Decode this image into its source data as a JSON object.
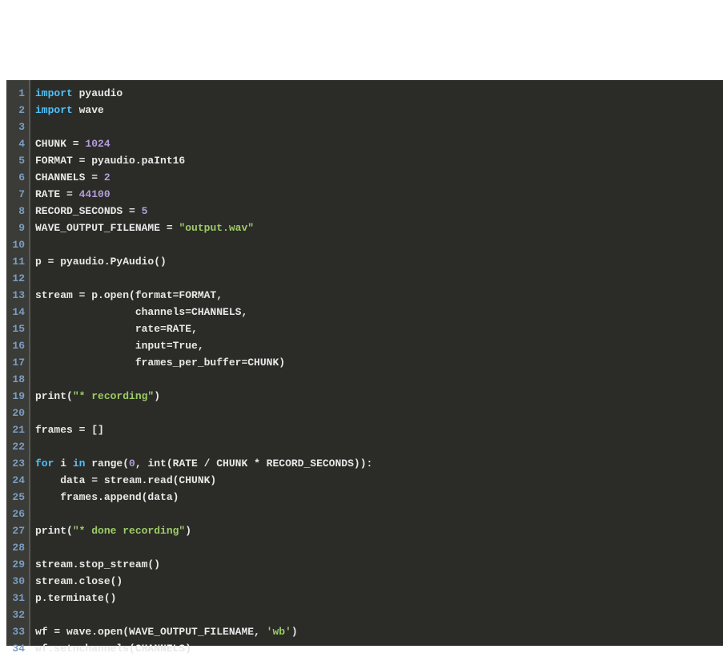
{
  "editor": {
    "gutter_start": 1,
    "gutter_end": 34,
    "lines": [
      [
        [
          "kw",
          "import"
        ],
        [
          "def",
          " pyaudio"
        ]
      ],
      [
        [
          "kw",
          "import"
        ],
        [
          "def",
          " wave"
        ]
      ],
      [],
      [
        [
          "def",
          "CHUNK = "
        ],
        [
          "num",
          "1024"
        ]
      ],
      [
        [
          "def",
          "FORMAT = pyaudio.paInt16"
        ]
      ],
      [
        [
          "def",
          "CHANNELS = "
        ],
        [
          "num",
          "2"
        ]
      ],
      [
        [
          "def",
          "RATE = "
        ],
        [
          "num",
          "44100"
        ]
      ],
      [
        [
          "def",
          "RECORD_SECONDS = "
        ],
        [
          "num",
          "5"
        ]
      ],
      [
        [
          "def",
          "WAVE_OUTPUT_FILENAME = "
        ],
        [
          "str",
          "\"output.wav\""
        ]
      ],
      [],
      [
        [
          "def",
          "p = pyaudio.PyAudio()"
        ]
      ],
      [],
      [
        [
          "def",
          "stream = p.open(format=FORMAT,"
        ]
      ],
      [
        [
          "def",
          "                channels=CHANNELS,"
        ]
      ],
      [
        [
          "def",
          "                rate=RATE,"
        ]
      ],
      [
        [
          "def",
          "                input=True,"
        ]
      ],
      [
        [
          "def",
          "                frames_per_buffer=CHUNK)"
        ]
      ],
      [],
      [
        [
          "def",
          "print("
        ],
        [
          "str",
          "\"* recording\""
        ],
        [
          "def",
          ")"
        ]
      ],
      [],
      [
        [
          "def",
          "frames = []"
        ]
      ],
      [],
      [
        [
          "kw",
          "for"
        ],
        [
          "def",
          " i "
        ],
        [
          "kw",
          "in"
        ],
        [
          "def",
          " range("
        ],
        [
          "num",
          "0"
        ],
        [
          "def",
          ", int(RATE / CHUNK * RECORD_SECONDS)):"
        ]
      ],
      [
        [
          "def",
          "    data = stream.read(CHUNK)"
        ]
      ],
      [
        [
          "def",
          "    frames.append(data)"
        ]
      ],
      [],
      [
        [
          "def",
          "print("
        ],
        [
          "str",
          "\"* done recording\""
        ],
        [
          "def",
          ")"
        ]
      ],
      [],
      [
        [
          "def",
          "stream.stop_stream()"
        ]
      ],
      [
        [
          "def",
          "stream.close()"
        ]
      ],
      [
        [
          "def",
          "p.terminate()"
        ]
      ],
      [],
      [
        [
          "def",
          "wf = wave.open(WAVE_OUTPUT_FILENAME, "
        ],
        [
          "str",
          "'wb'"
        ],
        [
          "def",
          ")"
        ]
      ],
      [
        [
          "def",
          "wf.setnchannels(CHANNELS)"
        ]
      ]
    ]
  }
}
